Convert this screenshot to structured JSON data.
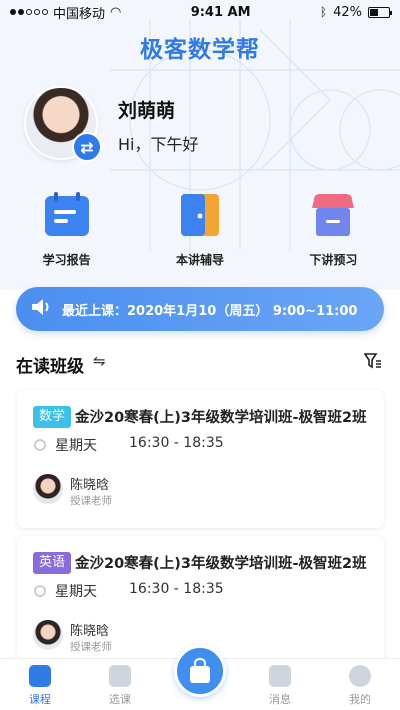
{
  "status_bar": {
    "carrier": "中国移动",
    "time": "9:41 AM",
    "battery": "42%",
    "battery_level": 0.42
  },
  "app": {
    "title": "极客数学帮"
  },
  "profile": {
    "name": "刘萌萌",
    "greeting": "Hi，下午好",
    "switch_icon": "swap-icon"
  },
  "quick_actions": [
    {
      "label": "学习报告",
      "icon": "report-icon",
      "color": "#3c82f0"
    },
    {
      "label": "本讲辅导",
      "icon": "door-icon",
      "color": "#f3a530"
    },
    {
      "label": "下讲预习",
      "icon": "box-icon",
      "color": "#5b8ef2"
    }
  ],
  "banner": {
    "icon": "speaker-icon",
    "text": "最近上课：2020年1月10（周五） 9:00~11:00"
  },
  "section": {
    "title": "在读班级",
    "swap_icon": "⇋",
    "filter_icon": "filter-icon"
  },
  "classes": [
    {
      "tag": "数学",
      "title": "金沙20寒春(上)3年级数学培训班-极智班2班",
      "day": "星期天",
      "time": "16:30 - 18:35",
      "teacher": "陈晓晗",
      "teacher_role": "授课老师"
    },
    {
      "tag": "英语",
      "title": "金沙20寒春(上)3年级数学培训班-极智班2班",
      "day": "星期天",
      "time": "16:30 - 18:35",
      "teacher": "陈晓晗",
      "teacher_role": "授课老师"
    }
  ],
  "tabs": [
    {
      "label": "课程",
      "icon": "course-icon",
      "active": true
    },
    {
      "label": "选课",
      "icon": "select-course-icon",
      "active": false
    },
    {
      "label": "",
      "icon": "bag-icon",
      "active": false
    },
    {
      "label": "消息",
      "icon": "message-icon",
      "active": false
    },
    {
      "label": "我的",
      "icon": "profile-icon",
      "active": false
    }
  ],
  "colors": {
    "primary": "#2f7be8",
    "math_tag": "#3cc0e8",
    "english_tag": "#8a6bdd"
  }
}
